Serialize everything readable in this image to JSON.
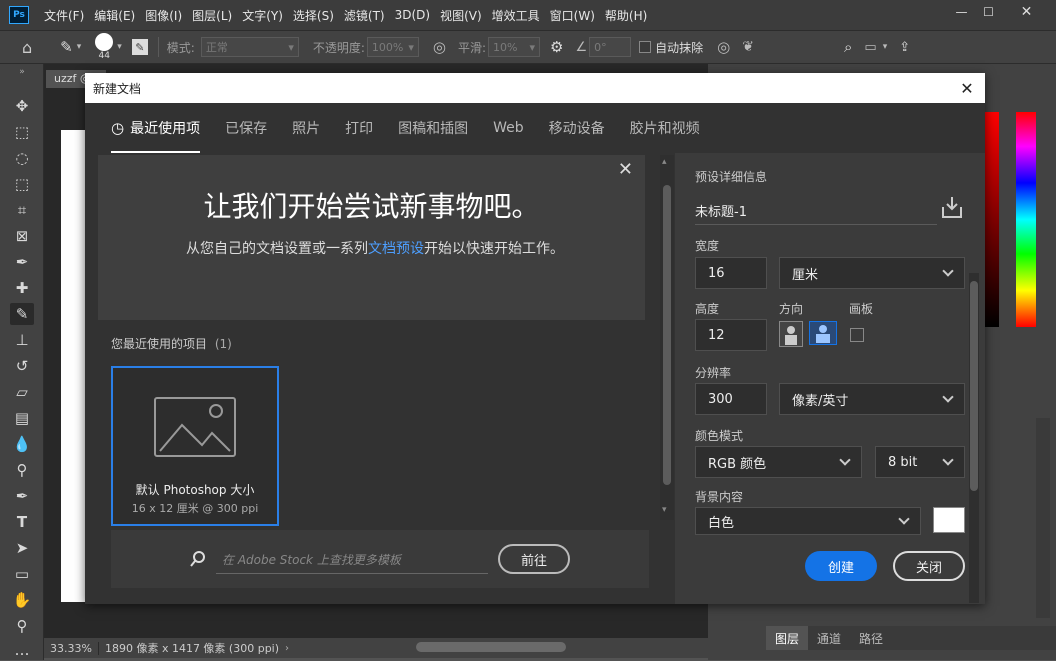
{
  "app": {
    "logo": "Ps"
  },
  "menu": [
    "文件(F)",
    "编辑(E)",
    "图像(I)",
    "图层(L)",
    "文字(Y)",
    "选择(S)",
    "滤镜(T)",
    "3D(D)",
    "视图(V)",
    "增效工具",
    "窗口(W)",
    "帮助(H)"
  ],
  "options": {
    "brush_size": "44",
    "mode_label": "模式:",
    "mode_value": "正常",
    "opacity_label": "不透明度:",
    "opacity_value": "100%",
    "smooth_label": "平滑:",
    "smooth_value": "10%",
    "angle_value": "0°",
    "auto_erase": "自动抹除"
  },
  "document": {
    "tab_label": "uzzf @"
  },
  "status": {
    "zoom": "33.33%",
    "info": "1890 像素 x 1417 像素 (300 ppi)"
  },
  "panels": {
    "tabs": [
      "图层",
      "通道",
      "路径"
    ]
  },
  "dialog": {
    "title": "新建文档",
    "tabs": [
      "最近使用项",
      "已保存",
      "照片",
      "打印",
      "图稿和插图",
      "Web",
      "移动设备",
      "胶片和视频"
    ],
    "banner": {
      "heading": "让我们开始尝试新事物吧。",
      "sub_before": "从您自己的文档设置或一系列",
      "sub_link": "文档预设",
      "sub_after": "开始以快速开始工作。"
    },
    "recent_label": "您最近使用的项目",
    "recent_count": "(1)",
    "recent_item": {
      "name": "默认 Photoshop 大小",
      "dims": "16 x 12 厘米 @ 300 ppi"
    },
    "stock": {
      "placeholder": "在 Adobe Stock 上查找更多模板",
      "go": "前往"
    },
    "preset": {
      "header": "预设详细信息",
      "name": "未标题-1",
      "width_label": "宽度",
      "width_value": "16",
      "width_unit": "厘米",
      "height_label": "高度",
      "height_value": "12",
      "orientation_label": "方向",
      "artboard_label": "画板",
      "resolution_label": "分辨率",
      "resolution_value": "300",
      "resolution_unit": "像素/英寸",
      "color_mode_label": "颜色模式",
      "color_mode_value": "RGB 颜色",
      "bit_depth": "8 bit",
      "bg_label": "背景内容",
      "bg_value": "白色",
      "bg_color": "#ffffff"
    },
    "create": "创建",
    "close": "关闭"
  }
}
